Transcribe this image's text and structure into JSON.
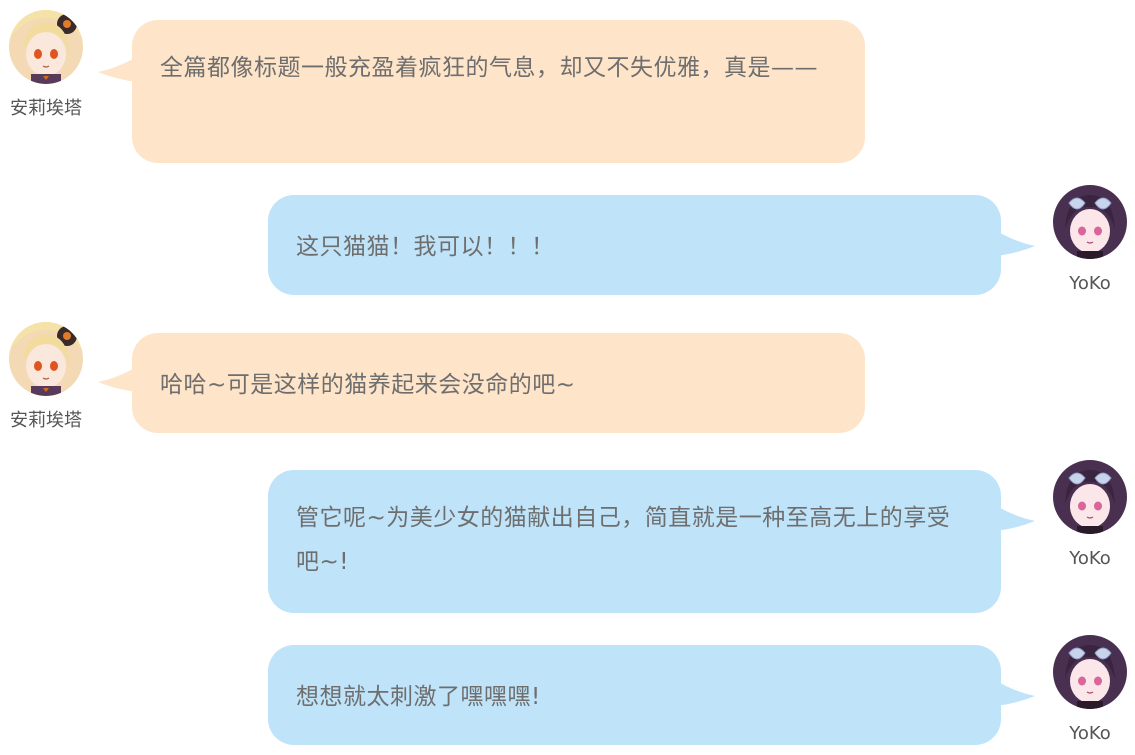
{
  "users": {
    "left": {
      "name": "安莉埃塔",
      "avatar_icon": "anime-girl-blonde-avatar-icon"
    },
    "right": {
      "name": "YoKo",
      "avatar_icon": "anime-girl-purple-avatar-icon"
    }
  },
  "colors": {
    "left_bubble": "#fee4c8",
    "right_bubble": "#bfe3f8",
    "text": "#6e6e6e",
    "name": "#555555"
  },
  "messages": [
    {
      "side": "left",
      "name": "安莉埃塔",
      "text": "全篇都像标题一般充盈着疯狂的气息，却又不失优雅，真是——"
    },
    {
      "side": "right",
      "name": "YoKo",
      "text": "这只猫猫！我可以！！！"
    },
    {
      "side": "left",
      "name": "安莉埃塔",
      "text": "哈哈~可是这样的猫养起来会没命的吧~"
    },
    {
      "side": "right",
      "name": "YoKo",
      "text": "管它呢~为美少女的猫献出自己，简直就是一种至高无上的享受吧~!"
    },
    {
      "side": "right",
      "name": "YoKo",
      "text": "想想就太刺激了嘿嘿嘿!"
    }
  ]
}
